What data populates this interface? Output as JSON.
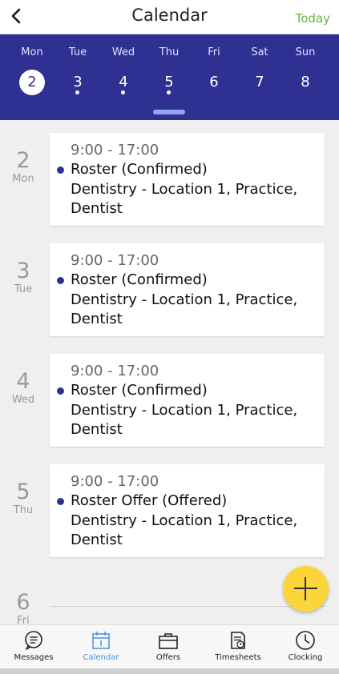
{
  "header": {
    "title": "Calendar",
    "today_label": "Today"
  },
  "week": [
    {
      "dow": "Mon",
      "date": "2",
      "selected": true,
      "has_event": false
    },
    {
      "dow": "Tue",
      "date": "3",
      "selected": false,
      "has_event": true
    },
    {
      "dow": "Wed",
      "date": "4",
      "selected": false,
      "has_event": true
    },
    {
      "dow": "Thu",
      "date": "5",
      "selected": false,
      "has_event": true
    },
    {
      "dow": "Fri",
      "date": "6",
      "selected": false,
      "has_event": false
    },
    {
      "dow": "Sat",
      "date": "7",
      "selected": false,
      "has_event": false
    },
    {
      "dow": "Sun",
      "date": "8",
      "selected": false,
      "has_event": false
    }
  ],
  "days": [
    {
      "date": "2",
      "dow": "Mon",
      "time": "9:00 - 17:00",
      "status": "Roster (Confirmed)",
      "details": "Dentistry - Location 1, Practice, Dentist"
    },
    {
      "date": "3",
      "dow": "Tue",
      "time": "9:00 - 17:00",
      "status": "Roster (Confirmed)",
      "details": "Dentistry - Location 1, Practice, Dentist"
    },
    {
      "date": "4",
      "dow": "Wed",
      "time": "9:00 - 17:00",
      "status": "Roster (Confirmed)",
      "details": "Dentistry - Location 1, Practice, Dentist"
    },
    {
      "date": "5",
      "dow": "Thu",
      "time": "9:00 - 17:00",
      "status": "Roster Offer (Offered)",
      "details": "Dentistry - Location 1, Practice, Dentist"
    },
    {
      "date": "6",
      "dow": "Fri"
    }
  ],
  "tabs": [
    {
      "label": "Messages",
      "icon": "messages-icon",
      "active": false
    },
    {
      "label": "Calendar",
      "icon": "calendar-icon",
      "active": true
    },
    {
      "label": "Offers",
      "icon": "briefcase-icon",
      "active": false
    },
    {
      "label": "Timesheets",
      "icon": "timesheet-icon",
      "active": false
    },
    {
      "label": "Clocking",
      "icon": "clock-icon",
      "active": false
    }
  ],
  "colors": {
    "brand": "#2e3192",
    "accent_green": "#6ab04c",
    "fab": "#fbd53a",
    "active_tab": "#4a90e2"
  }
}
